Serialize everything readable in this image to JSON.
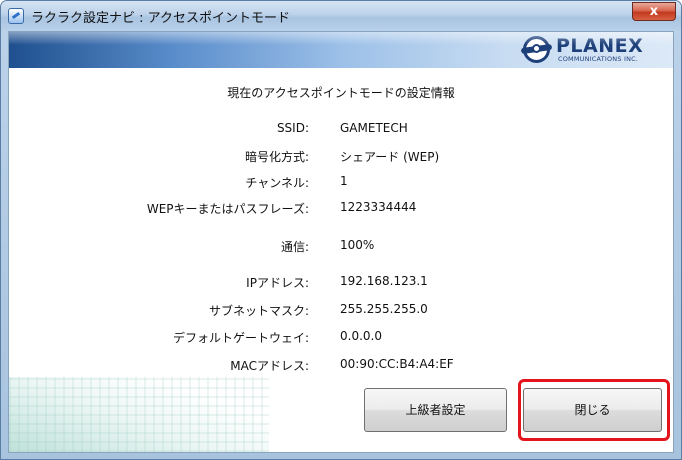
{
  "window": {
    "title": "ラクラク設定ナビ : アクセスポイントモード",
    "close_glyph": "x"
  },
  "brand": {
    "name": "PLANEX",
    "sub": "COMMUNICATIONS INC."
  },
  "heading": "現在のアクセスポイントモードの設定情報",
  "info": {
    "ssid": {
      "label": "SSID:",
      "value": "GAMETECH"
    },
    "encryption": {
      "label": "暗号化方式:",
      "value": "シェアード (WEP)"
    },
    "channel": {
      "label": "チャンネル:",
      "value": "1"
    },
    "key": {
      "label": "WEPキーまたはパスフレーズ:",
      "value": "1223334444"
    },
    "signal": {
      "label": "通信:",
      "value": "100%"
    },
    "ip": {
      "label": "IPアドレス:",
      "value": "192.168.123.1"
    },
    "subnet": {
      "label": "サブネットマスク:",
      "value": "255.255.255.0"
    },
    "gateway": {
      "label": "デフォルトゲートウェイ:",
      "value": "0.0.0.0"
    },
    "mac": {
      "label": "MACアドレス:",
      "value": "00:90:CC:B4:A4:EF"
    }
  },
  "buttons": {
    "advanced": "上級者設定",
    "close": "閉じる"
  },
  "colors": {
    "highlight": "#e3141b",
    "brand": "#1d3f7a"
  }
}
